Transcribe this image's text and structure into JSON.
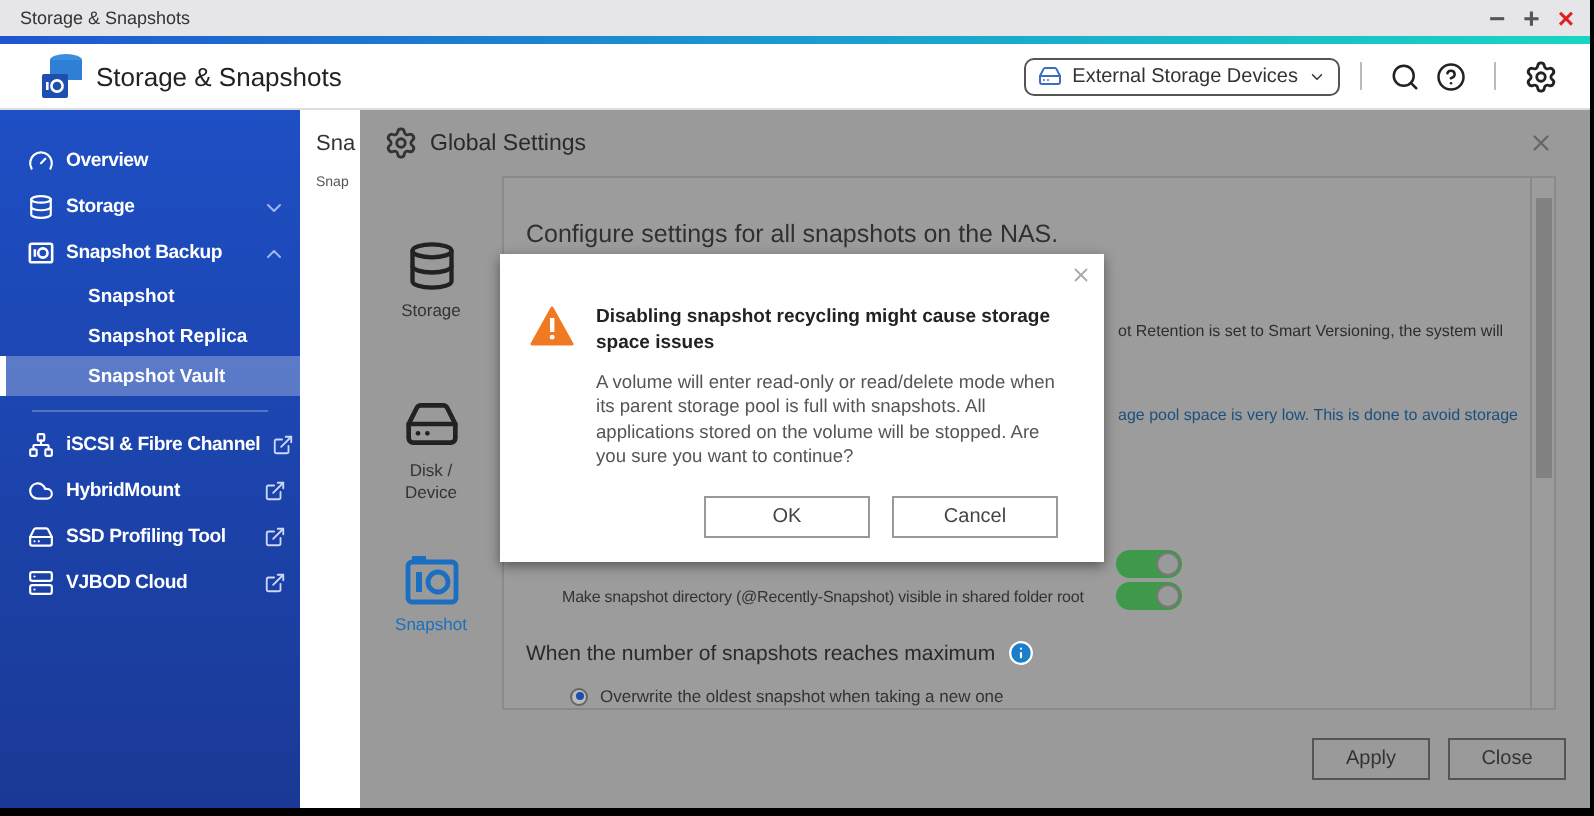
{
  "window": {
    "title": "Storage & Snapshots",
    "controls": [
      {
        "kind": "minimize",
        "label": "−"
      },
      {
        "kind": "maximize",
        "label": "+"
      },
      {
        "kind": "close",
        "label": "×"
      }
    ]
  },
  "app": {
    "title": "Storage & Snapshots",
    "device_menu": "External Storage Devices"
  },
  "sidebar": {
    "items": [
      {
        "kind": "overview",
        "label": "Overview",
        "selected": false
      },
      {
        "kind": "storage",
        "label": "Storage",
        "expanded": false,
        "selected": false
      },
      {
        "kind": "snapshot",
        "label": "Snapshot Backup",
        "expanded": true,
        "selected": false,
        "children": [
          {
            "label": "Snapshot",
            "selected": false
          },
          {
            "label": "Snapshot Replica",
            "selected": false
          },
          {
            "label": "Snapshot Vault",
            "selected": true
          }
        ]
      },
      {
        "kind": "iscsi",
        "label": "iSCSI & Fibre Channel",
        "external": true,
        "selected": false
      },
      {
        "kind": "hybrid",
        "label": "HybridMount",
        "external": true,
        "selected": false
      },
      {
        "kind": "ssd",
        "label": "SSD Profiling Tool",
        "external": true,
        "selected": false
      },
      {
        "kind": "vjbod",
        "label": "VJBOD Cloud",
        "external": true,
        "selected": false
      }
    ]
  },
  "page": {
    "title": "Sna",
    "subtitle": "Snap"
  },
  "settings": {
    "title": "Global Settings",
    "tabs": [
      {
        "kind": "storage",
        "label": "Storage",
        "selected": false
      },
      {
        "kind": "disk",
        "label": "Disk / Device",
        "selected": false
      },
      {
        "kind": "snapshot",
        "label": "Snapshot",
        "selected": true
      }
    ],
    "heading": "Configure settings for all snapshots on the NAS.",
    "fragments": [
      {
        "kind": "text",
        "text": "ot Retention is set to Smart Versioning, the system will"
      },
      {
        "kind": "link",
        "text": "age pool space is very low. This is done to avoid storage"
      }
    ],
    "toggles": [
      {
        "on": true
      },
      {
        "label": "Make snapshot directory (@Recently-Snapshot) visible in shared folder root",
        "on": true
      }
    ],
    "section": "When the number of snapshots reaches maximum",
    "options": [
      {
        "label": "Overwrite the oldest snapshot when taking a new one",
        "selected": true
      }
    ],
    "buttons": [
      "Apply",
      "Close"
    ]
  },
  "dialog": {
    "title": "Disabling snapshot recycling might cause storage space issues",
    "message": "A volume will enter read-only or read/delete mode when its parent storage pool is full with snapshots. All applications stored on the volume will be stopped. Are you sure you want to continue?",
    "buttons": [
      "OK",
      "Cancel"
    ]
  }
}
